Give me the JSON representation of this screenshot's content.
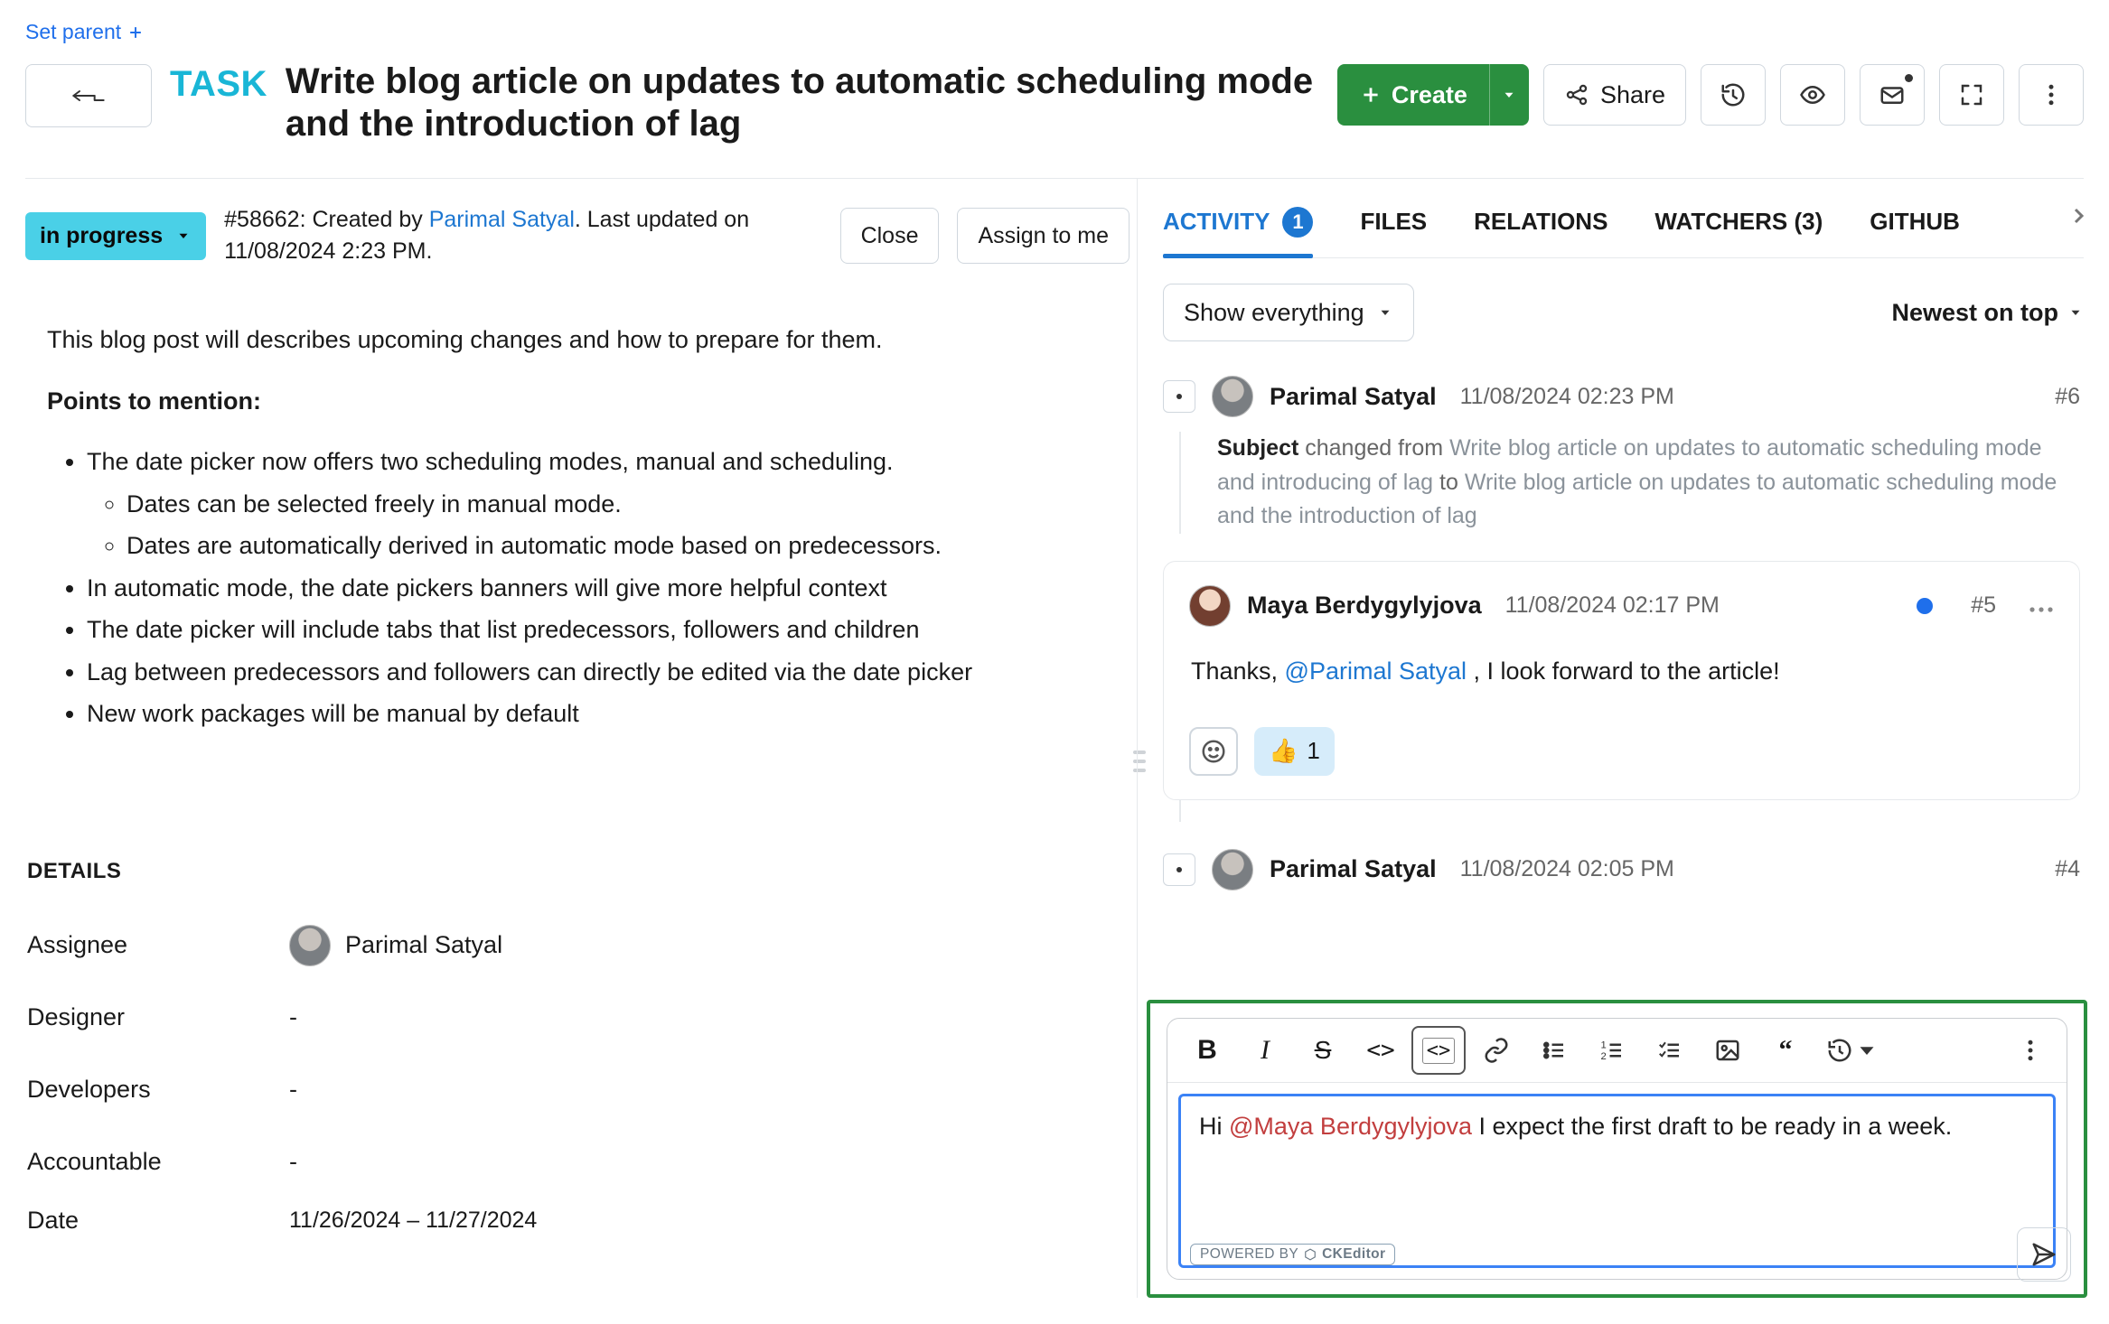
{
  "set_parent": {
    "label": "Set parent"
  },
  "header": {
    "type_label": "TASK",
    "title": "Write blog article on updates to automatic scheduling mode and the introduction of lag",
    "create_label": "Create",
    "share_label": "Share"
  },
  "meta": {
    "status": "in progress",
    "id_created_prefix": "#58662: Created by ",
    "creator": "Parimal Satyal",
    "last_updated_label": ". Last updated on 11/08/2024 2:23 PM.",
    "close_label": "Close",
    "assign_me_label": "Assign to me"
  },
  "desc": {
    "intro": "This blog post will describes upcoming changes and how to prepare for them.",
    "points_h": "Points to mention:",
    "b1": "The date picker now offers two scheduling modes, manual and scheduling.",
    "b1a": "Dates can be selected freely in manual mode.",
    "b1b": "Dates are automatically derived in automatic mode based on predecessors.",
    "b2": "In automatic mode, the date pickers banners will give more helpful context",
    "b3": "The date picker will include tabs that list predecessors, followers and children",
    "b4": "Lag between predecessors and followers can directly be edited via the date picker",
    "b5": "New work packages will be manual by default"
  },
  "details": {
    "heading": "DETAILS",
    "assignee_label": "Assignee",
    "assignee_value": "Parimal Satyal",
    "designer_label": "Designer",
    "designer_value": "-",
    "developers_label": "Developers",
    "developers_value": "-",
    "accountable_label": "Accountable",
    "accountable_value": "-",
    "date_label": "Date",
    "date_value": "11/26/2024 – 11/27/2024"
  },
  "tabs": {
    "activity": "ACTIVITY",
    "activity_count": "1",
    "files": "FILES",
    "relations": "RELATIONS",
    "watchers": "WATCHERS (3)",
    "github": "GITHUB"
  },
  "filters": {
    "show_label": "Show everything",
    "sort_label": "Newest on top"
  },
  "activity": {
    "item1": {
      "author": "Parimal Satyal",
      "ts": "11/08/2024 02:23 PM",
      "num": "#6",
      "subject_label": "Subject",
      "change_pre": " changed from ",
      "from": "Write blog article on updates to automatic scheduling mode and introducing of lag",
      "to_label": " to ",
      "to": "Write blog article on updates to automatic scheduling mode and the introduction of lag"
    },
    "item2": {
      "author": "Maya Berdygylyjova",
      "ts": "11/08/2024 02:17 PM",
      "num": "#5",
      "body_pre": "Thanks, ",
      "mention": "@Parimal Satyal",
      "body_post": " , I look forward to the article!",
      "react_count": "1"
    },
    "item3": {
      "author": "Parimal Satyal",
      "ts": "11/08/2024 02:05 PM",
      "num": "#4"
    }
  },
  "editor": {
    "pre": "Hi ",
    "mention": "@Maya Berdygylyjova",
    "post": " I expect the first draft to be ready in a week.",
    "powered_pre": "POWERED BY ",
    "powered_brand": "CKEditor"
  }
}
